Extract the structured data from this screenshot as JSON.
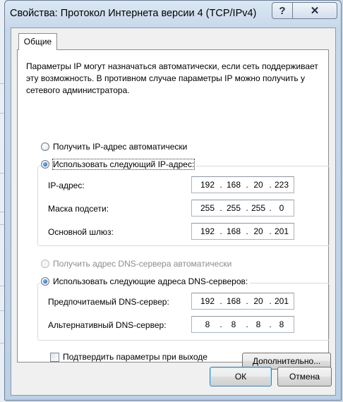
{
  "window": {
    "title": "Свойства: Протокол Интернета версии 4 (TCP/IPv4)",
    "help_glyph": "?",
    "close_glyph": "✕"
  },
  "tabs": [
    {
      "label": "Общие",
      "selected": true
    }
  ],
  "description": "Параметры IP могут назначаться автоматически, если сеть поддерживает эту возможность. В противном случае параметры IP можно получить у сетевого администратора.",
  "ip_mode": {
    "auto_label": "Получить IP-адрес автоматически",
    "manual_label": "Использовать следующий IP-адрес:",
    "selected": "manual"
  },
  "ip_fields": [
    {
      "label": "IP-адрес:",
      "octets": [
        "192",
        "168",
        "20",
        "223"
      ]
    },
    {
      "label": "Маска подсети:",
      "octets": [
        "255",
        "255",
        "255",
        "0"
      ]
    },
    {
      "label": "Основной шлюз:",
      "octets": [
        "192",
        "168",
        "20",
        "201"
      ]
    }
  ],
  "dns_mode": {
    "auto_label": "Получить адрес DNS-сервера автоматически",
    "manual_label": "Использовать следующие адреса DNS-серверов:",
    "selected": "manual"
  },
  "dns_fields": [
    {
      "label": "Предпочитаемый DNS-сервер:",
      "octets": [
        "192",
        "168",
        "20",
        "201"
      ]
    },
    {
      "label": "Альтернативный DNS-сервер:",
      "octets": [
        "8",
        "8",
        "8",
        "8"
      ]
    }
  ],
  "validate_on_exit": {
    "label": "Подтвердить параметры при выходе",
    "checked": false
  },
  "buttons": {
    "advanced": "Дополнительно...",
    "ok": "ОК",
    "cancel": "Отмена"
  }
}
